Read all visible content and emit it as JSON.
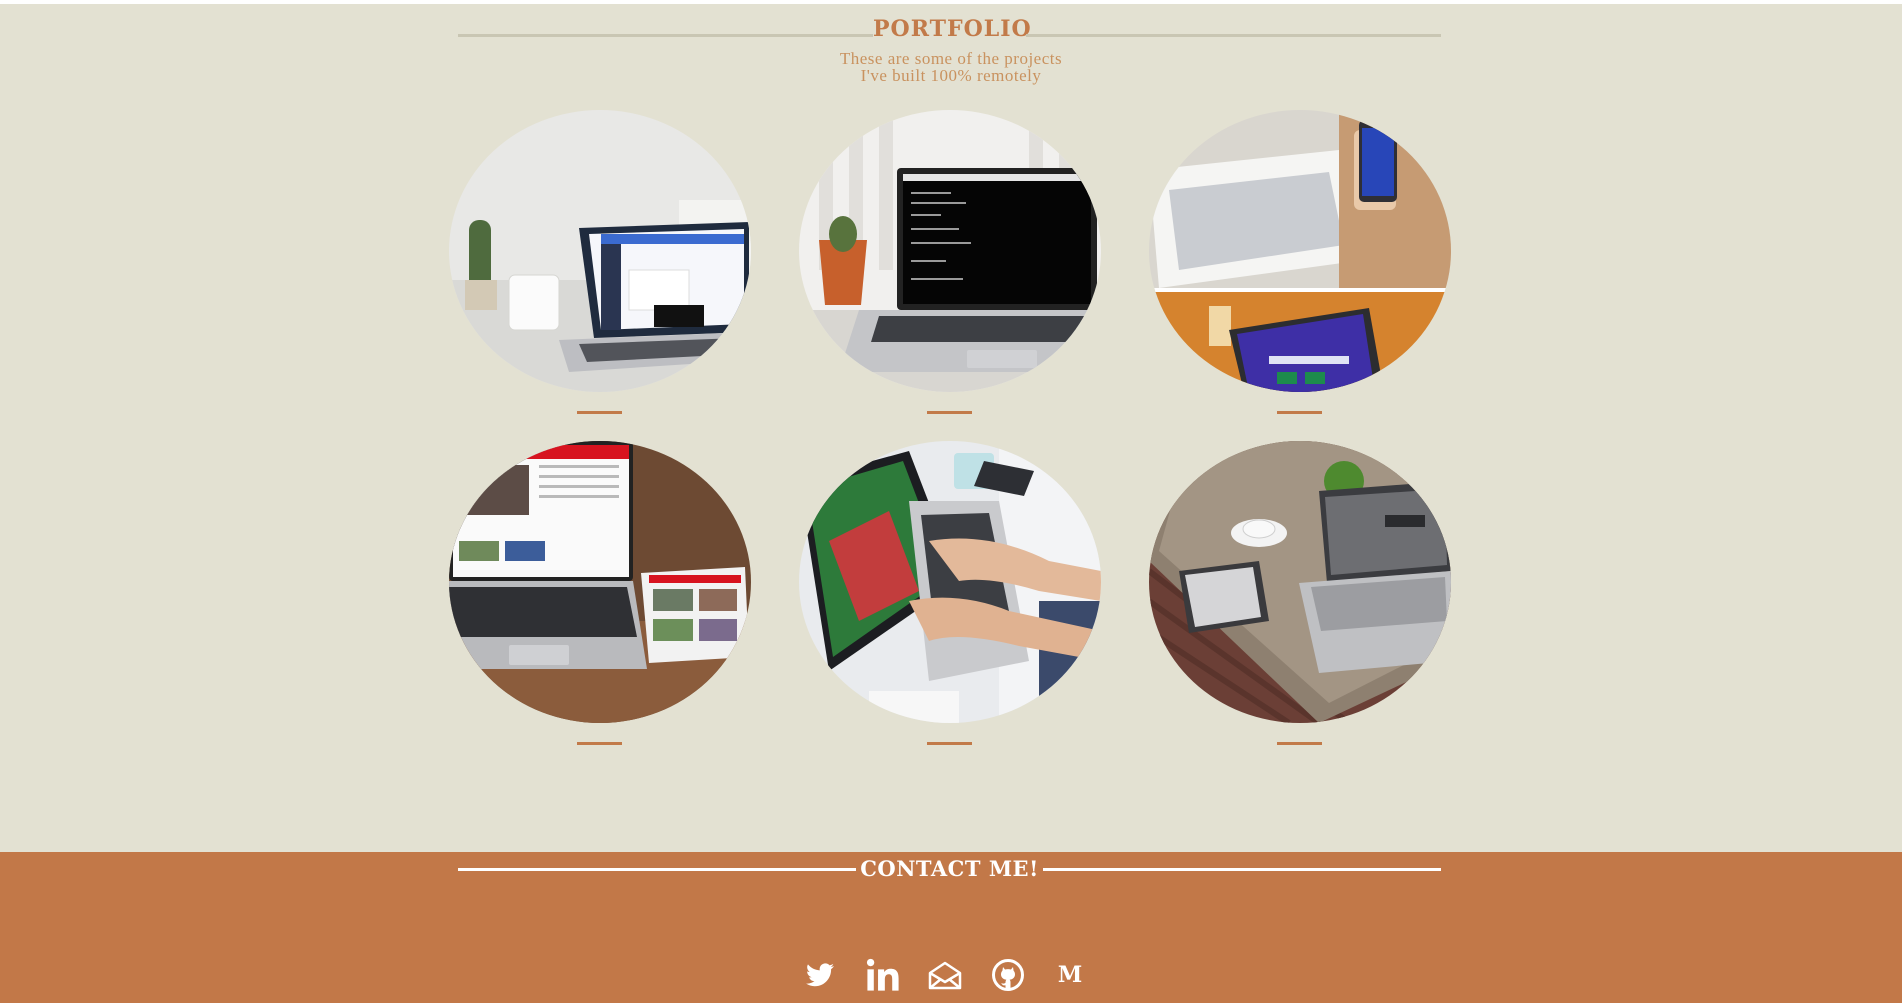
{
  "portfolio": {
    "title": "PORTFOLIO",
    "subtitle_line1": "These are some of the projects",
    "subtitle_line2": "I've built 100% remotely",
    "projects": [
      {
        "image": "laptop-dashboard-photo"
      },
      {
        "image": "dell-laptop-terminal-photo"
      },
      {
        "image": "phone-and-laptop-website-photo"
      },
      {
        "image": "newsweek-laptop-tablet-photo"
      },
      {
        "image": "hands-typing-laptop-photo"
      },
      {
        "image": "laptop-tablet-desk-photo"
      }
    ]
  },
  "contact": {
    "title": "CONTACT ME!",
    "social": [
      {
        "icon": "twitter-icon"
      },
      {
        "icon": "linkedin-icon"
      },
      {
        "icon": "email-icon"
      },
      {
        "icon": "github-icon"
      },
      {
        "icon": "medium-icon",
        "label": "M"
      }
    ]
  },
  "colors": {
    "portfolio_background": "#e3e1d2",
    "accent": "#c27a49",
    "contact_background": "#c27848",
    "divider": "#c9c6b3"
  }
}
